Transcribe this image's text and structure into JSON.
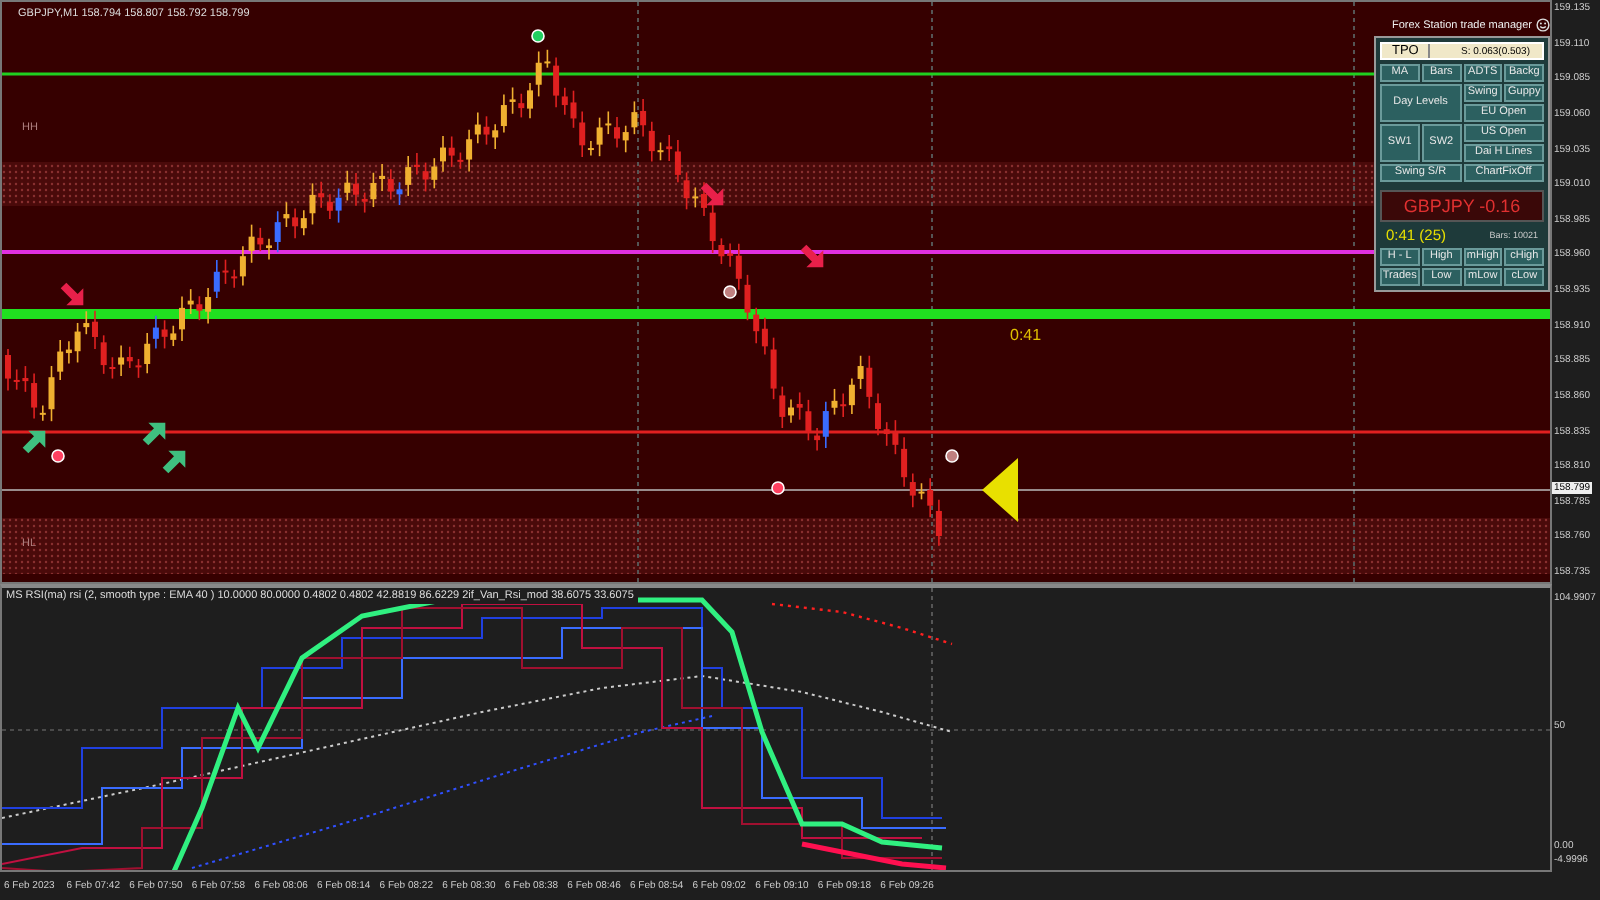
{
  "chart": {
    "title": "GBPJPY,M1 158.794 158.807 158.792 158.799",
    "zone_labels": [
      "HH",
      "HL"
    ],
    "timer": "0:41"
  },
  "price_axis": {
    "ticks": [
      "159.135",
      "159.110",
      "159.085",
      "159.060",
      "159.035",
      "159.010",
      "158.985",
      "158.960",
      "158.935",
      "158.910",
      "158.885",
      "158.860",
      "158.835",
      "158.810",
      "158.785",
      "158.760",
      "158.735"
    ],
    "current": "158.799"
  },
  "trade_manager": {
    "title": "Forex Station trade manager",
    "tpo": {
      "label": "TPO",
      "value": "S: 0.063(0.503)"
    },
    "buttons": [
      "MA",
      "Bars",
      "ADTS",
      "Backg",
      "Day Levels",
      "Swing",
      "Guppy",
      "EU Open",
      "SW1",
      "SW2",
      "US Open",
      "Dai H Lines",
      "Swing S/R",
      "ChartFixOff"
    ],
    "symbol_change": "GBPJPY -0.16",
    "timer": "0:41 (25)",
    "bars": "Bars: 10021",
    "bottom_buttons": [
      "H - L",
      "High",
      "mHigh",
      "cHigh",
      "Trades",
      "Low",
      "mLow",
      "cLow"
    ]
  },
  "indicator": {
    "title": "MS RSI(ma) rsi (2, smooth type : EMA  40 ) 10.0000 80.0000 0.4802 0.4802 42.8819 86.6229  2if_Van_Rsi_mod 38.6075 33.6075",
    "ticks": [
      "104.9907",
      "50",
      "0.00",
      "-4.9996"
    ]
  },
  "time_axis": [
    "6 Feb 2023",
    "6 Feb 07:42",
    "6 Feb 07:50",
    "6 Feb 07:58",
    "6 Feb 08:06",
    "6 Feb 08:14",
    "6 Feb 08:22",
    "6 Feb 08:30",
    "6 Feb 08:38",
    "6 Feb 08:46",
    "6 Feb 08:54",
    "6 Feb 09:02",
    "6 Feb 09:10",
    "6 Feb 09:18",
    "6 Feb 09:26"
  ]
}
